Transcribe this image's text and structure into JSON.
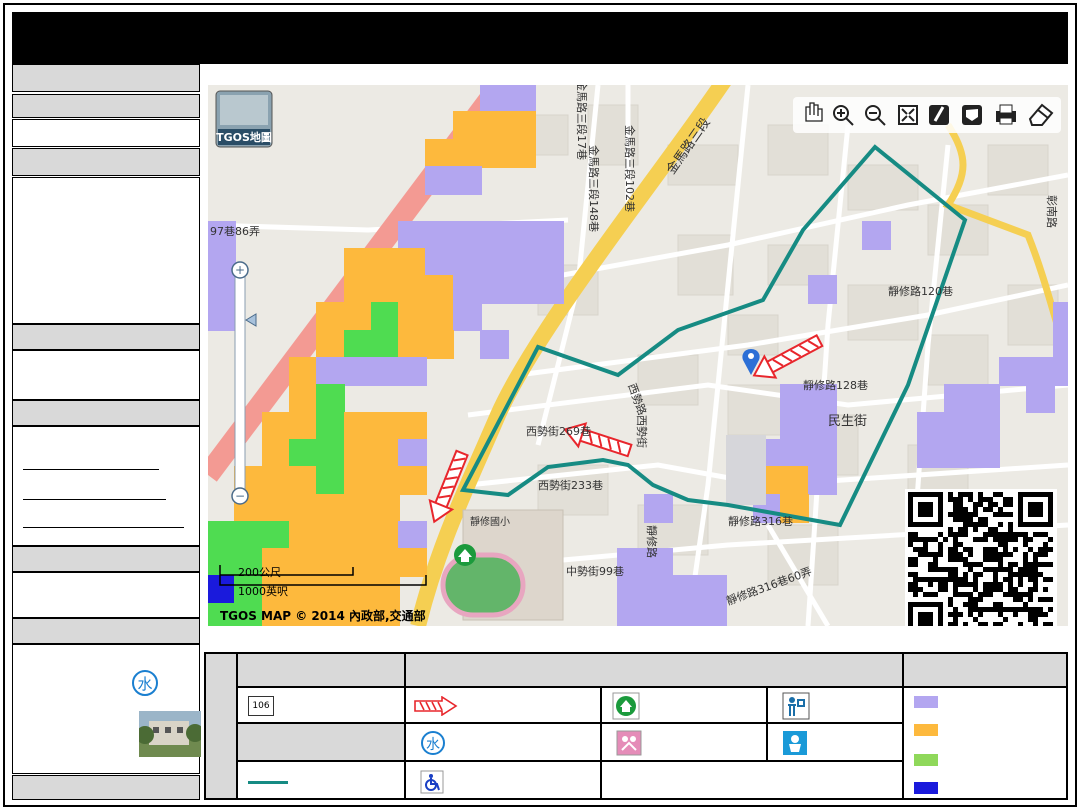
{
  "map": {
    "attribution": "TGOS MAP © 2014 內政部,交通部",
    "logo_label": "TGOS地圖",
    "scale_bar": {
      "metric": "200公尺",
      "imperial": "1000英呎"
    },
    "road_labels": [
      {
        "id": "r1",
        "text": "金馬路三段"
      },
      {
        "id": "r2",
        "text": "金馬路三段102巷"
      },
      {
        "id": "r3",
        "text": "金馬路三段148巷"
      },
      {
        "id": "r4",
        "text": "金馬路三段17巷"
      },
      {
        "id": "r5",
        "text": "97巷86弄"
      },
      {
        "id": "r6",
        "text": "西勢路"
      },
      {
        "id": "r7",
        "text": "西勢街269巷"
      },
      {
        "id": "r8",
        "text": "西勢街233巷"
      },
      {
        "id": "r9",
        "text": "靜修路128巷"
      },
      {
        "id": "r10",
        "text": "靜修路316巷"
      },
      {
        "id": "r11",
        "text": "靜修路316巷60弄"
      },
      {
        "id": "r12",
        "text": "中勢街99巷"
      },
      {
        "id": "r13",
        "text": "民生街"
      },
      {
        "id": "r14",
        "text": "彰南路"
      },
      {
        "id": "r15",
        "text": "靜修路120巷"
      },
      {
        "id": "r16",
        "text": "西勢街"
      },
      {
        "id": "r17",
        "text": "靜修路"
      },
      {
        "id": "r18",
        "text": "靜修國小"
      }
    ]
  },
  "legend": {
    "road_shield": "106"
  },
  "colors": {
    "title_bar": "#000000",
    "header_gray": "#d9d9d9",
    "boundary": "#168b83",
    "evac_arrow": "#e8262c",
    "flood_level_1": "#b3a6f0",
    "flood_level_2": "#fdb93d",
    "flood_level_3": "#4fdc51",
    "flood_level_4": "#1a1adc",
    "major_road": "#f5cf52",
    "expressway": "#f39a93"
  },
  "icons": [
    "hand-pan-icon",
    "zoom-in-icon",
    "zoom-out-icon",
    "full-extent-icon",
    "draw-line-icon",
    "draw-polygon-icon",
    "print-icon",
    "eraser-icon",
    "shelter-icon",
    "water-icon",
    "wheelchair-icon",
    "aid-station-icon",
    "nursery-icon",
    "baby-care-icon",
    "qr-code-icon",
    "location-pin-icon"
  ]
}
